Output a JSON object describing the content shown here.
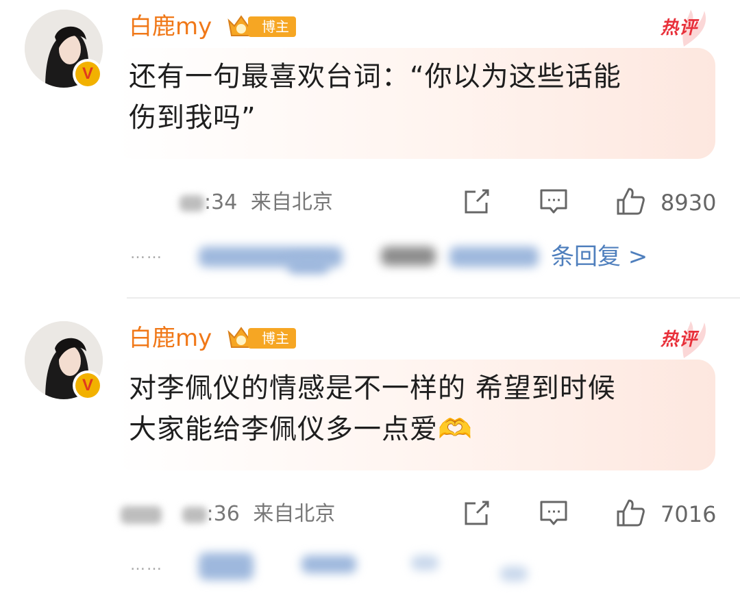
{
  "comments": [
    {
      "username": "白鹿my",
      "badge": "博主",
      "hot_label": "热评",
      "text_line1": "还有一句最喜欢台词：“你以为这些话能",
      "text_line2": "伤到我吗”",
      "time": ":34",
      "location": "来自北京",
      "like_count": "8930",
      "reply_link": "条回复 >"
    },
    {
      "username": "白鹿my",
      "badge": "博主",
      "hot_label": "热评",
      "text_line1": "对李佩仪的情感是不一样的 希望到时候",
      "text_line2": "大家能给李佩仪多一点爱🫶",
      "time": ":36",
      "location": "来自北京",
      "like_count": "7016"
    }
  ],
  "icons": [
    "verified-v-icon",
    "crown-level-icon",
    "share-icon",
    "comment-icon",
    "like-icon",
    "heart-hands-emoji"
  ],
  "colors": {
    "username": "#f07818",
    "hot": "#e8303a",
    "reply_link": "#4f7fbd",
    "badge": "#f6a623"
  }
}
